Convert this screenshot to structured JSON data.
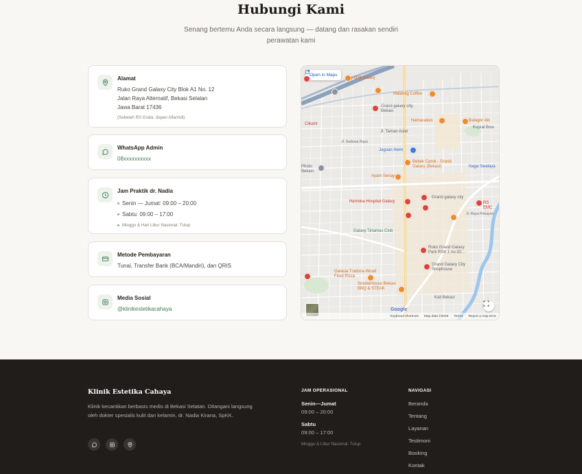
{
  "header": {
    "title": "Hubungi Kami",
    "subtitle": "Senang bertemu Anda secara langsung — datang dan rasakan sendiri perawatan kami"
  },
  "contact": {
    "address": {
      "title": "Alamat",
      "line1": "Ruko Grand Galaxy City Blok A1 No. 12",
      "line2": "Jalan Raya Alternatif, Bekasi Selatan",
      "line3": "Jawa Barat 17436",
      "note": "(Sebelah RS Grata, dopan Alfamidi)"
    },
    "whatsapp": {
      "title": "WhatsApp Admin",
      "number": "08xxxxxxxxxx"
    },
    "hours": {
      "title": "Jam Praktik dr. Nadia",
      "items": [
        "Senin — Jumat: 09:00 – 20:00",
        "Sabtu: 09:00 – 17:00"
      ],
      "note": "Minggu & Hari Libur Nasional: Tutup"
    },
    "payment": {
      "title": "Metode Pembayaran",
      "text": "Tunai, Transfer Bank (BCA/Mandiri), dan QRIS"
    },
    "social": {
      "title": "Media Sosial",
      "handle": "@klinikestetikacahaya"
    }
  },
  "map": {
    "open_label": "Open in Maps",
    "labels": {
      "grill": "y Grill Galaxy",
      "malamig": "Malamig Coffee",
      "grand_galaxy_bekasi": "Grand galaxy city, Bekasi",
      "namacakes": "Namacakes",
      "batagor": "Batagor Aki",
      "kopral": "Kopral Bow",
      "cikunir": "Cikunir",
      "taman_aster": "Jl. Taman Aster",
      "sadewa": "Jl. Sadewa Raya",
      "jagoan": "Jagoan Helm",
      "bebek": "Bebek Carok - Grand Galaxy (Bekasi)",
      "naga": "Naga Swalaya",
      "photo": "Photo Bekasi",
      "ayam": "Ayam Senayu",
      "hermina": "Hermina Hospital Galaxy",
      "grand_galaxy_city": "Grand galaxy city",
      "rs_emc": "RS EMC",
      "tirtamas": "Galaxy Tirtamas Club",
      "ruko": "Ruko Grand Galaxy Park RSK 1 no.32...",
      "shophouse": "Grand Galaxy City Shophouse",
      "trattoria": "Galasia Trattoria Wood Fired Pizza",
      "smokehouse": "SmokeHouse Bekasi BBQ & STEAK",
      "kali_bekasi": "Kali Bekasi",
      "raya_pekayon": "Jl. Raya Pekayon",
      "google": "Google",
      "shortcuts": "Keyboard shortcuts",
      "mapdata": "Map data ©2026",
      "terms": "Terms",
      "report": "Report a map error"
    }
  },
  "footer": {
    "brand": "Klinik Estetika Cahaya",
    "desc": "Klinik kecantikan berbasis medis di Bekasi Selatan. Ditangani langsung oleh dokter spesialis kulit dan kelamin, dr. Nadia Kirana, SpKK.",
    "ops_heading": "JAM OPERASIONAL",
    "ops": [
      {
        "day": "Senin—Jumat",
        "time": "09:00 – 20:00"
      },
      {
        "day": "Sabtu",
        "time": "09:00 – 17:00"
      }
    ],
    "ops_note": "Minggu & Libur Nasional: Tutup",
    "nav_heading": "NAVIGASI",
    "nav": [
      "Beranda",
      "Tentang",
      "Layanan",
      "Testimoni",
      "Booking",
      "Kontak"
    ]
  }
}
